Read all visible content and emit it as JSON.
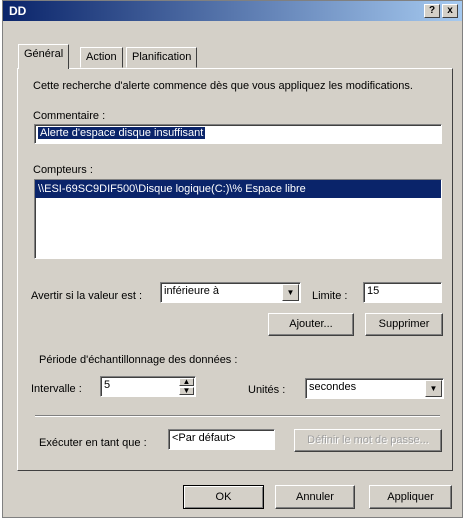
{
  "window": {
    "title": "DD",
    "help_label": "?",
    "close_label": "x"
  },
  "tabs": [
    {
      "label": "Général",
      "active": true
    },
    {
      "label": "Action",
      "active": false
    },
    {
      "label": "Planification",
      "active": false
    }
  ],
  "general": {
    "intro": "Cette recherche d'alerte commence dès que vous appliquez les modifications.",
    "comment_label": "Commentaire :",
    "comment_value": "Alerte d'espace disque insuffisant",
    "counters_label": "Compteurs :",
    "counters": [
      "\\\\ESI-69SC9DIF500\\Disque logique(C:)\\% Espace libre"
    ],
    "alert_if_label": "Avertir si la valeur est :",
    "alert_if_value": "inférieure à",
    "limit_label": "Limite :",
    "limit_value": "15",
    "add_label": "Ajouter...",
    "remove_label": "Supprimer",
    "sampling_label": "Période d'échantillonnage des données :",
    "interval_label": "Intervalle :",
    "interval_value": "5",
    "units_label": "Unités :",
    "units_value": "secondes",
    "run_as_label": "Exécuter en tant que :",
    "run_as_value": "<Par défaut>",
    "set_password_label": "Définir le mot de passe..."
  },
  "footer": {
    "ok_label": "OK",
    "cancel_label": "Annuler",
    "apply_label": "Appliquer"
  }
}
